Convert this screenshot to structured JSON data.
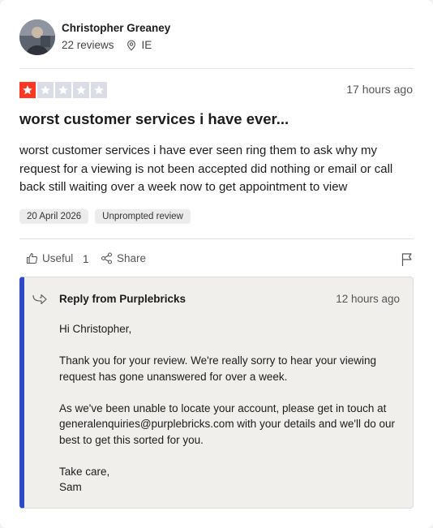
{
  "review": {
    "author": {
      "name": "Christopher Greaney",
      "reviews_count": "22 reviews",
      "country": "IE"
    },
    "rating": 1,
    "rating_max": 5,
    "colors": {
      "star_active": "#ff3722",
      "star_inactive": "#dcdce6",
      "reply_accent": "#2c49c7"
    },
    "time": "17 hours ago",
    "title": "worst customer services i have ever...",
    "body": "worst customer services i have ever seen ring them to ask why my request for a viewing is not been accepted did nothing or email or call back still waiting over a week now to get appointment to view",
    "tags": [
      "20 April 2026",
      "Unprompted review"
    ]
  },
  "actions": {
    "useful_label": "Useful",
    "useful_count": "1",
    "share_label": "Share"
  },
  "reply": {
    "from": "Reply from Purplebricks",
    "time": "12 hours ago",
    "greeting": "Hi Christopher,",
    "paragraph_1": "Thank you for your review. We're really sorry to hear your viewing request has gone unanswered for over a week.",
    "paragraph_2": "As we've been unable to locate your account, please get in touch at generalenquiries@purplebricks.com with your details and we'll do our best to get this sorted for you.",
    "signoff": "Take care,",
    "signature": "Sam"
  }
}
